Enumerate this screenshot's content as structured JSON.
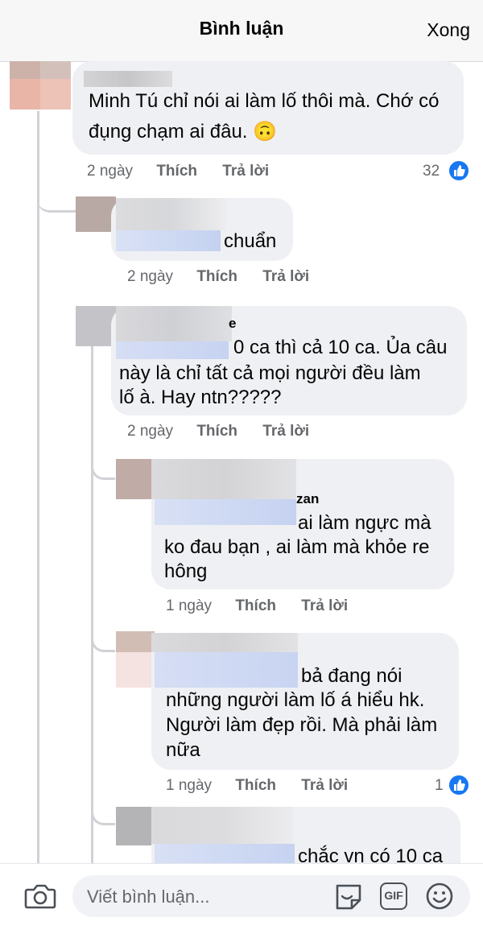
{
  "header": {
    "title": "Bình luận",
    "done_label": "Xong"
  },
  "comments": [
    {
      "text_lines": [
        "Minh Tú chỉ nói ai làm lố thôi mà. Chớ có",
        "đụng chạm ai đâu. 🙃"
      ],
      "time": "2 ngày",
      "like": "Thích",
      "reply": "Trả lời",
      "reactions": "32"
    },
    {
      "text_lines": [
        "chuẩn"
      ],
      "time": "2 ngày",
      "like": "Thích",
      "reply": "Trả lời"
    },
    {
      "name_partial": "e",
      "text_lines": [
        "0 ca thì cả 10 ca. Ủa câu",
        "này là chỉ tất cả mọi người đều làm",
        "lố à. Hay ntn?????"
      ],
      "time": "2 ngày",
      "like": "Thích",
      "reply": "Trả lời"
    },
    {
      "name_partial": "zan",
      "text_lines": [
        "ai làm ngực mà",
        "ko đau bạn , ai làm mà khỏe re",
        "hông"
      ],
      "time": "1 ngày",
      "like": "Thích",
      "reply": "Trả lời"
    },
    {
      "text_lines": [
        "bả đang nói",
        "những người làm lố á hiểu hk.",
        "Người làm đẹp rồi. Mà phải làm",
        "nữa"
      ],
      "time": "1 ngày",
      "like": "Thích",
      "reply": "Trả lời",
      "reactions": "1"
    },
    {
      "text_lines": [
        "chắc vn có 10 ca"
      ]
    }
  ],
  "composer": {
    "placeholder": "Viết bình luận..."
  },
  "icons": {
    "camera": "camera-icon",
    "sticker": "sticker-icon",
    "gif": "gif-icon",
    "gif_text": "GIF",
    "emoji": "emoji-icon",
    "like": "like-icon"
  },
  "colors": {
    "accent": "#1877f2",
    "bubble": "#eff0f3",
    "meta": "#65676b"
  }
}
